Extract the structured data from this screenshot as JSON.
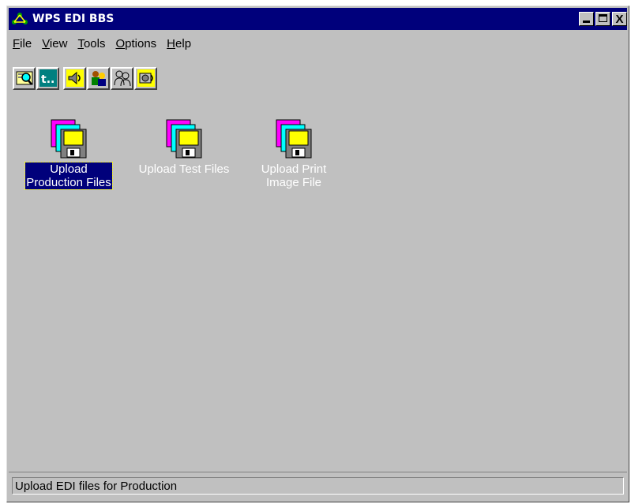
{
  "window": {
    "title": "WPS EDI BBS",
    "controls": {
      "minimize": "_",
      "maximize": "□",
      "close": "X"
    }
  },
  "menu": [
    {
      "label": "File",
      "accel": "F",
      "rest": "ile"
    },
    {
      "label": "View",
      "accel": "V",
      "rest": "iew"
    },
    {
      "label": "Tools",
      "accel": "T",
      "rest": "ools"
    },
    {
      "label": "Options",
      "accel": "O",
      "rest": "ptions"
    },
    {
      "label": "Help",
      "accel": "H",
      "rest": "elp"
    }
  ],
  "toolbar": {
    "buttons": [
      {
        "icon": "find-icon"
      },
      {
        "icon": "upload-arrow-icon",
        "text": "t.."
      },
      {
        "icon": "speaker-icon"
      },
      {
        "icon": "users-icon"
      },
      {
        "icon": "users-outline-icon"
      },
      {
        "icon": "sound-settings-icon"
      }
    ]
  },
  "files": [
    {
      "label_line1": "Upload",
      "label_line2": "Production Files",
      "selected": true
    },
    {
      "label_line1": "Upload Test Files",
      "label_line2": "",
      "selected": false
    },
    {
      "label_line1": "Upload Print",
      "label_line2": "Image File",
      "selected": false
    }
  ],
  "status": {
    "text": "Upload EDI files for Production"
  },
  "colors": {
    "titlebar": "#00007b",
    "window_bg": "#c0c0c0",
    "selection": "#00007b"
  }
}
